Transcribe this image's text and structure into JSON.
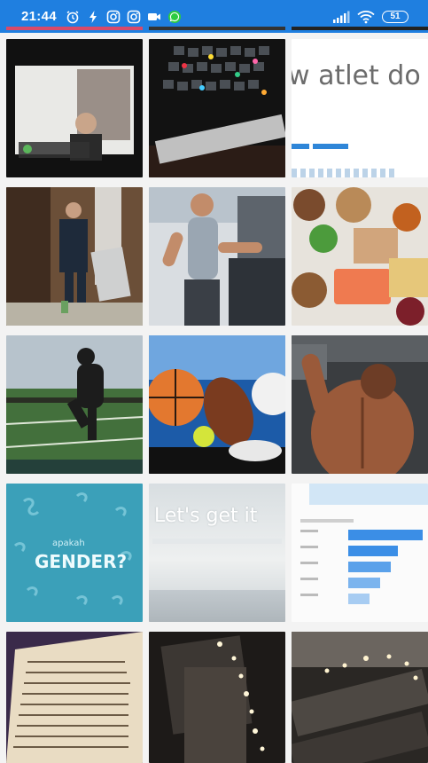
{
  "status_bar": {
    "time": "21:44",
    "battery": "51",
    "left_icons": [
      "alarm-icon",
      "flash-icon",
      "instagram-icon",
      "instagram-icon",
      "video-call-icon",
      "whatsapp-icon"
    ],
    "right_icons": [
      "signal-icon",
      "wifi-icon",
      "battery-icon"
    ]
  },
  "tiles": {
    "r1c3_text": "w atlet do s",
    "r4c1_text_small": "apakah",
    "r4c1_text": "GENDER?",
    "r4c2_text": "Let's get it"
  },
  "colors": {
    "status_bar": "#1f7fe0",
    "background": "#f3f3f3",
    "chart_bar": "#3b8ee6"
  }
}
